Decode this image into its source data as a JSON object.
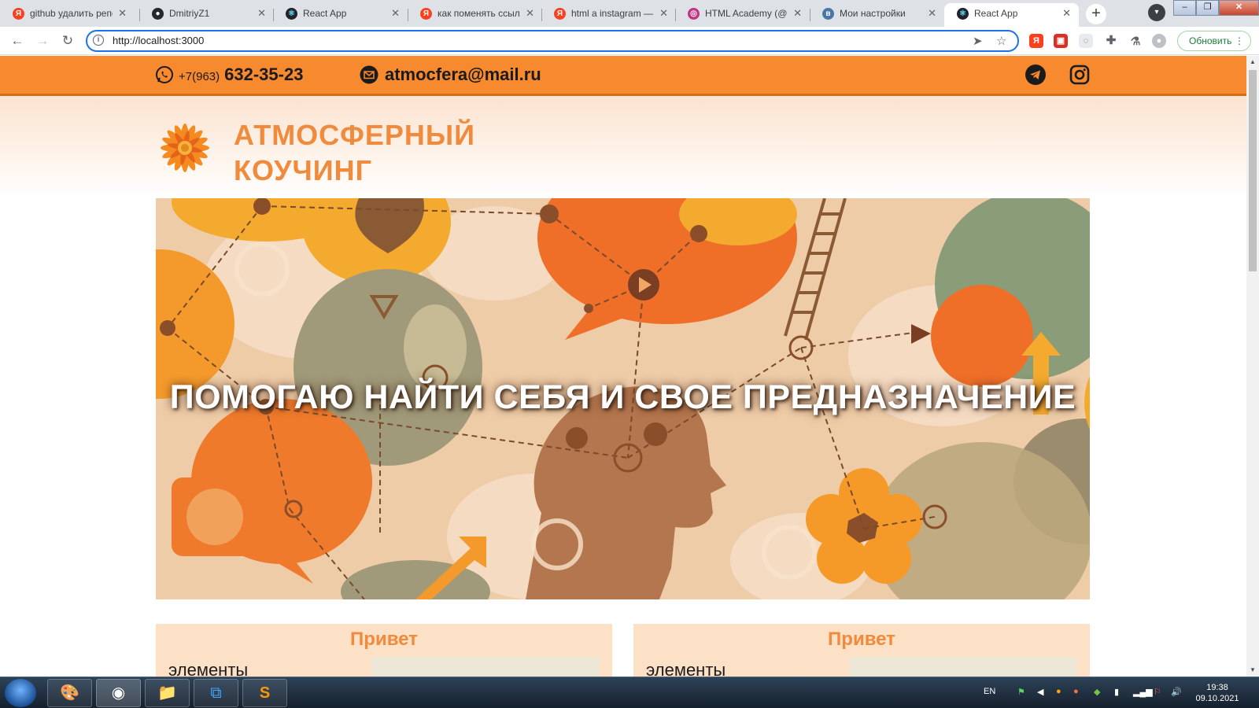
{
  "browser": {
    "tabs": [
      {
        "label": "github удалить репозиторий",
        "favicon": "Я",
        "favicon_color": "#fc3f1d"
      },
      {
        "label": "DmitriyZ1",
        "favicon": "GH",
        "favicon_color": "#24292e"
      },
      {
        "label": "React App",
        "favicon": "⚛",
        "favicon_color": "#20232a"
      },
      {
        "label": "как поменять ссылку",
        "favicon": "Я",
        "favicon_color": "#fc3f1d"
      },
      {
        "label": "html a instagram —",
        "favicon": "Я",
        "favicon_color": "#fc3f1d"
      },
      {
        "label": "HTML Academy (@h",
        "favicon": "◎",
        "favicon_color": "#c13584"
      },
      {
        "label": "Мои настройки",
        "favicon": "VK",
        "favicon_color": "#4a76a8"
      },
      {
        "label": "React App",
        "favicon": "⚛",
        "favicon_color": "#20232a"
      }
    ],
    "active_tab": 7,
    "close_glyph": "✕",
    "new_tab_glyph": "+",
    "address": "http://localhost:3000",
    "update_label": "Обновить"
  },
  "page": {
    "phone_prefix": "+7(963)",
    "phone_number": "632-35-23",
    "email": "atmocfera@mail.ru",
    "brand_line1": "АТМОСФЕРНЫЙ",
    "brand_line2": "КОУЧИНГ",
    "hero_title": "ПОМОГАЮ НАЙТИ СЕБЯ И СВОЕ ПРЕДНАЗНАЧЕНИЕ",
    "cards": [
      {
        "title": "Привет",
        "text": "элементы"
      },
      {
        "title": "Привет",
        "text": "элементы"
      }
    ],
    "accent_color": "#f7892f",
    "brand_color": "#f08a3c"
  },
  "taskbar": {
    "language": "EN",
    "time": "19:38",
    "date": "09.10.2021"
  }
}
